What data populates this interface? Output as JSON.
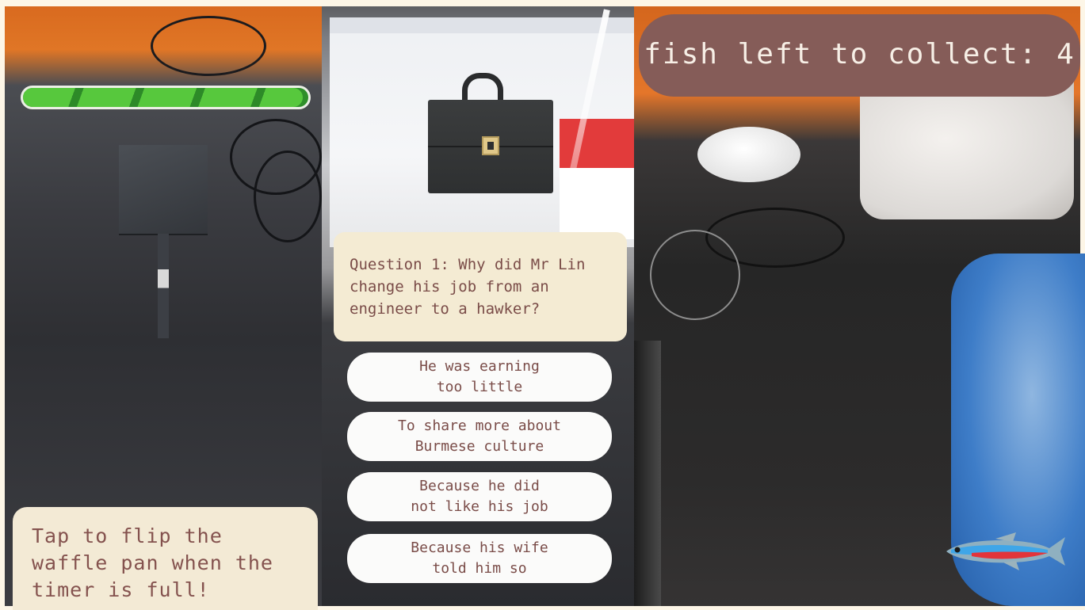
{
  "waffle_game": {
    "timer_progress": 0.98,
    "hint": "Tap to flip the waffle pan when the timer is full!"
  },
  "quiz_game": {
    "question": "Question 1: Why did Mr Lin change his job from an engineer to a hawker?",
    "answers": [
      "He was earning\ntoo little",
      "To share more about\nBurmese culture",
      "Because he did\nnot like his job",
      "Because his wife\ntold him so"
    ],
    "prop_icon": "briefcase-icon"
  },
  "fish_game": {
    "counter": "fish left to collect: 4",
    "fish_icon": "neon-tetra-icon"
  },
  "colors": {
    "label_text": "#84524e",
    "label_bg": "#f3ead5",
    "counter_bg": "#855c58",
    "progress_green": "#57c83d"
  }
}
